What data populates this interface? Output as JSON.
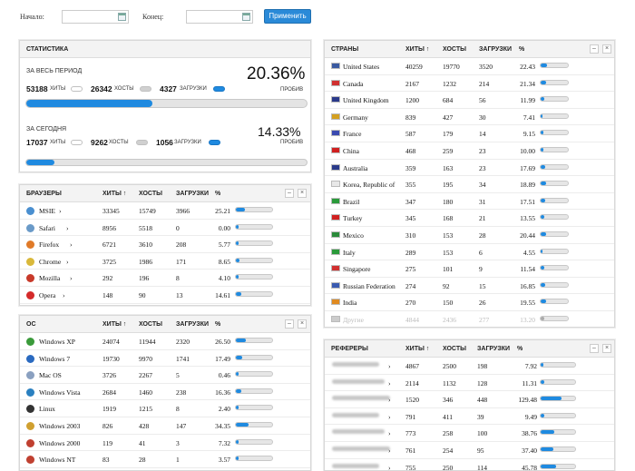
{
  "filters": {
    "start_label": "Начало:",
    "end_label": "Конец:",
    "apply_label": "Применить",
    "start_value": "",
    "end_value": ""
  },
  "stats": {
    "title": "СТАТИСТИКА",
    "all": {
      "label": "ЗА ВЕСЬ ПЕРИОД",
      "hits": "53188",
      "hits_label": "ХИТЫ",
      "hosts": "26342",
      "hosts_label": "ХОСТЫ",
      "loads": "4327",
      "loads_label": "ЗАГРУЗКИ",
      "pct": "20.36%",
      "pct_label": "ПРОБИВ",
      "progress": 0.45
    },
    "today": {
      "label": "ЗА СЕГОДНЯ",
      "hits": "17037",
      "hits_label": "ХИТЫ",
      "hosts": "9262",
      "hosts_label": "ХОСТЫ",
      "loads": "1056",
      "loads_label": "ЗАГРУЗКИ",
      "pct": "14.33%",
      "pct_label": "ПРОБИВ",
      "progress": 0.1
    }
  },
  "browsers": {
    "title": "БРАУЗЕРЫ",
    "col_hits": "ХИТЫ ↑",
    "col_hosts": "ХОСТЫ",
    "col_loads": "ЗАГРУЗКИ",
    "col_pct": "%",
    "rows": [
      {
        "name": "MSIE",
        "hits": "33345",
        "hosts": "15749",
        "loads": "3966",
        "pct": "25.21",
        "fill": 0.25,
        "icon": "msie-icon",
        "color": "#4a8fd0"
      },
      {
        "name": "Safari",
        "hits": "8956",
        "hosts": "5518",
        "loads": "0",
        "pct": "0.00",
        "fill": 0.0,
        "icon": "safari-icon",
        "color": "#6a9ac8"
      },
      {
        "name": "Firefox",
        "hits": "6721",
        "hosts": "3610",
        "loads": "208",
        "pct": "5.77",
        "fill": 0.06,
        "icon": "firefox-icon",
        "color": "#e07a28"
      },
      {
        "name": "Chrome",
        "hits": "3725",
        "hosts": "1986",
        "loads": "171",
        "pct": "8.65",
        "fill": 0.09,
        "icon": "chrome-icon",
        "color": "#d9b83a"
      },
      {
        "name": "Mozilla",
        "hits": "292",
        "hosts": "196",
        "loads": "8",
        "pct": "4.10",
        "fill": 0.04,
        "icon": "mozilla-icon",
        "color": "#c83a2a"
      },
      {
        "name": "Opera",
        "hits": "148",
        "hosts": "90",
        "loads": "13",
        "pct": "14.61",
        "fill": 0.15,
        "icon": "opera-icon",
        "color": "#d42a2a"
      }
    ]
  },
  "os": {
    "title": "ОС",
    "col_hits": "ХИТЫ ↑",
    "col_hosts": "ХОСТЫ",
    "col_loads": "ЗАГРУЗКИ",
    "col_pct": "%",
    "rows": [
      {
        "name": "Windows XP",
        "hits": "24074",
        "hosts": "11944",
        "loads": "2320",
        "pct": "26.50",
        "fill": 0.27,
        "icon": "windows-icon",
        "color": "#3a9a3a"
      },
      {
        "name": "Windows 7",
        "hits": "19730",
        "hosts": "9970",
        "loads": "1741",
        "pct": "17.49",
        "fill": 0.17,
        "icon": "windows7-icon",
        "color": "#2a6ac0"
      },
      {
        "name": "Mac OS",
        "hits": "3726",
        "hosts": "2267",
        "loads": "5",
        "pct": "0.46",
        "fill": 0.005,
        "icon": "mac-icon",
        "color": "#8aa0c0"
      },
      {
        "name": "Windows Vista",
        "hits": "2684",
        "hosts": "1460",
        "loads": "238",
        "pct": "16.36",
        "fill": 0.16,
        "icon": "vista-icon",
        "color": "#2a80c0"
      },
      {
        "name": "Linux",
        "hits": "1919",
        "hosts": "1215",
        "loads": "8",
        "pct": "2.40",
        "fill": 0.024,
        "icon": "linux-icon",
        "color": "#333333"
      },
      {
        "name": "Windows 2003",
        "hits": "826",
        "hosts": "428",
        "loads": "147",
        "pct": "34.35",
        "fill": 0.34,
        "icon": "windows-icon",
        "color": "#d0a030"
      },
      {
        "name": "Windows 2000",
        "hits": "119",
        "hosts": "41",
        "loads": "3",
        "pct": "7.32",
        "fill": 0.07,
        "icon": "windows-icon",
        "color": "#c04030"
      },
      {
        "name": "Windows NT",
        "hits": "83",
        "hosts": "28",
        "loads": "1",
        "pct": "3.57",
        "fill": 0.036,
        "icon": "windows-icon",
        "color": "#c04030"
      }
    ]
  },
  "countries": {
    "title": "СТРАНЫ",
    "col_hits": "ХИТЫ ↑",
    "col_hosts": "ХОСТЫ",
    "col_loads": "ЗАГРУЗКИ",
    "col_pct": "%",
    "rows": [
      {
        "name": "United States",
        "hits": "40259",
        "hosts": "19770",
        "loads": "3520",
        "pct": "22.43",
        "fill": 0.22,
        "color": "#3a5aa0"
      },
      {
        "name": "Canada",
        "hits": "2167",
        "hosts": "1232",
        "loads": "214",
        "pct": "21.34",
        "fill": 0.21,
        "color": "#d03030"
      },
      {
        "name": "United Kingdom",
        "hits": "1200",
        "hosts": "684",
        "loads": "56",
        "pct": "11.99",
        "fill": 0.12,
        "color": "#2a3a8a"
      },
      {
        "name": "Germany",
        "hits": "839",
        "hosts": "427",
        "loads": "30",
        "pct": "7.41",
        "fill": 0.07,
        "color": "#d4a020"
      },
      {
        "name": "France",
        "hits": "587",
        "hosts": "179",
        "loads": "14",
        "pct": "9.15",
        "fill": 0.09,
        "color": "#3a4ab0"
      },
      {
        "name": "China",
        "hits": "468",
        "hosts": "259",
        "loads": "23",
        "pct": "10.00",
        "fill": 0.1,
        "color": "#d02020"
      },
      {
        "name": "Australia",
        "hits": "359",
        "hosts": "163",
        "loads": "23",
        "pct": "17.69",
        "fill": 0.18,
        "color": "#2a3a8a"
      },
      {
        "name": "Korea, Republic of",
        "hits": "355",
        "hosts": "195",
        "loads": "34",
        "pct": "18.89",
        "fill": 0.19,
        "color": "#e8e8e8"
      },
      {
        "name": "Brazil",
        "hits": "347",
        "hosts": "180",
        "loads": "31",
        "pct": "17.51",
        "fill": 0.18,
        "color": "#2a9a3a"
      },
      {
        "name": "Turkey",
        "hits": "345",
        "hosts": "168",
        "loads": "21",
        "pct": "13.55",
        "fill": 0.14,
        "color": "#d02020"
      },
      {
        "name": "Mexico",
        "hits": "310",
        "hosts": "153",
        "loads": "28",
        "pct": "20.44",
        "fill": 0.2,
        "color": "#2a8a3a"
      },
      {
        "name": "Italy",
        "hits": "289",
        "hosts": "153",
        "loads": "6",
        "pct": "4.55",
        "fill": 0.045,
        "color": "#2a9a3a"
      },
      {
        "name": "Singapore",
        "hits": "275",
        "hosts": "101",
        "loads": "9",
        "pct": "11.54",
        "fill": 0.12,
        "color": "#d03030"
      },
      {
        "name": "Russian Federation",
        "hits": "274",
        "hosts": "92",
        "loads": "15",
        "pct": "16.85",
        "fill": 0.17,
        "color": "#3a5ab0"
      },
      {
        "name": "India",
        "hits": "270",
        "hosts": "150",
        "loads": "26",
        "pct": "19.55",
        "fill": 0.2,
        "color": "#e08a20"
      },
      {
        "name": "Другие",
        "hits": "4844",
        "hosts": "2436",
        "loads": "277",
        "pct": "13.20",
        "fill": 0.13,
        "color": "#cccccc"
      }
    ]
  },
  "referrers": {
    "title": "РЕФЕРЕРЫ",
    "col_hits": "ХИТЫ ↑",
    "col_hosts": "ХОСТЫ",
    "col_loads": "ЗАГРУЗКИ",
    "col_pct": "%",
    "rows": [
      {
        "hits": "4867",
        "hosts": "2500",
        "loads": "198",
        "pct": "7.92",
        "fill": 0.08
      },
      {
        "hits": "2114",
        "hosts": "1132",
        "loads": "128",
        "pct": "11.31",
        "fill": 0.11
      },
      {
        "hits": "1520",
        "hosts": "346",
        "loads": "448",
        "pct": "129.48",
        "fill": 0.6
      },
      {
        "hits": "791",
        "hosts": "411",
        "loads": "39",
        "pct": "9.49",
        "fill": 0.095
      },
      {
        "hits": "773",
        "hosts": "258",
        "loads": "100",
        "pct": "38.76",
        "fill": 0.39
      },
      {
        "hits": "761",
        "hosts": "254",
        "loads": "95",
        "pct": "37.40",
        "fill": 0.37
      },
      {
        "hits": "755",
        "hosts": "250",
        "loads": "114",
        "pct": "45.78",
        "fill": 0.46
      }
    ]
  },
  "controls": {
    "minimize": "–",
    "close": "×"
  }
}
